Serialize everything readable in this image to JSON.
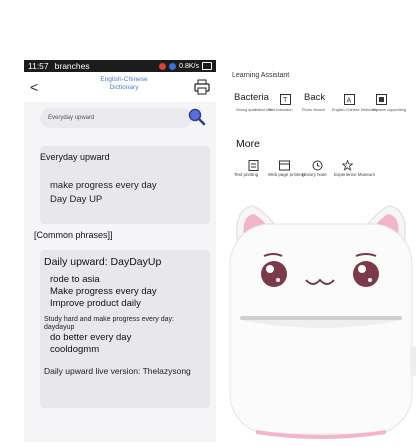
{
  "statusbar": {
    "time": "11:57",
    "carrier": "branches",
    "net": "0.8K/s"
  },
  "topbar": {
    "back": "<",
    "title": "English-Chinese Dictionary"
  },
  "search": {
    "value": "Everyday upward"
  },
  "result": {
    "query": "Everyday upward",
    "lines": [
      "make progress every day",
      "Day Day UP"
    ]
  },
  "common_label": "[Common phrases]]",
  "phrases": {
    "heading": "Daily upward: DayDayUp",
    "items": [
      "rode to asia",
      "Make progress every day",
      "Improve product daily"
    ],
    "study": "Study hard and make progress every day:",
    "study2": "daydayup",
    "items2": [
      "do better every day",
      "cooldogmm"
    ],
    "live": "Daily upward live version: Thelazysong"
  },
  "assistant": {
    "title": "Learning Assistant",
    "word1": "Bacteria",
    "word2": "Back",
    "small_labels": [
      "Strong qualitative text",
      "Text extraction",
      "Photo Search",
      "English-Chinese Dictionary",
      "Chinese copywriting"
    ],
    "more": "More",
    "more_labels": [
      "Text printing",
      "Web page printing",
      "History Note",
      "Experience Museum"
    ]
  },
  "colors": {
    "accent": "#4a7bd0",
    "pink": "#f4b9cc",
    "dark": "#1c1c1c"
  }
}
